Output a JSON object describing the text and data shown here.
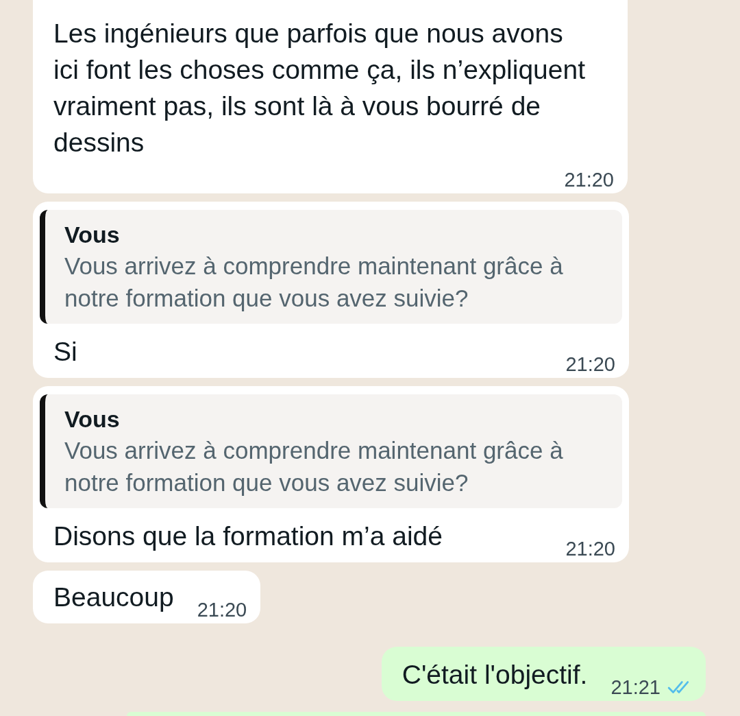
{
  "messages": [
    {
      "kind": "incoming",
      "clipped_top": true,
      "text": "Les ingénieurs que parfois que nous avons ici font les choses comme ça, ils n’expliquent vraiment pas, ils sont là à vous bourré de dessins",
      "time": "21:20"
    },
    {
      "kind": "incoming",
      "quote": {
        "author": "Vous",
        "text": "Vous arrivez à comprendre maintenant grâce à notre formation que vous avez suivie?"
      },
      "text": "Si",
      "time": "21:20"
    },
    {
      "kind": "incoming",
      "quote": {
        "author": "Vous",
        "text": "Vous arrivez à comprendre maintenant grâce à notre formation que vous avez suivie?"
      },
      "text": "Disons que la formation m’a aidé",
      "time": "21:20"
    },
    {
      "kind": "incoming",
      "text": "Beaucoup",
      "time": "21:20"
    },
    {
      "kind": "outgoing",
      "text": "C'était l'objectif.",
      "time": "21:21",
      "read": true
    },
    {
      "kind": "outgoing_edge"
    }
  ]
}
